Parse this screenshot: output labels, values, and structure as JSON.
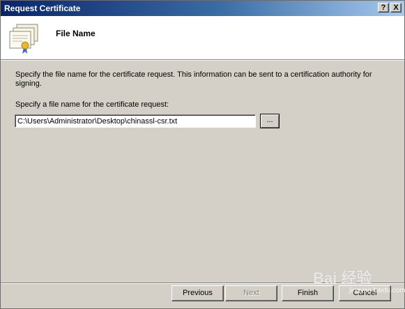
{
  "window": {
    "title": "Request Certificate",
    "help_label": "?",
    "close_label": "X"
  },
  "header": {
    "title": "File Name",
    "icon": "certificate-icon"
  },
  "content": {
    "description": "Specify the file name for the certificate request. This information can be sent to a certification authority for signing.",
    "field_label": "Specify a file name for the certificate request:",
    "file_value": "C:\\Users\\Administrator\\Desktop\\chinassl-csr.txt",
    "browse_label": "..."
  },
  "buttons": {
    "previous": "Previous",
    "next": "Next",
    "finish": "Finish",
    "cancel": "Cancel"
  },
  "watermark": {
    "text": "Bai 经验",
    "sub": "jingyan.baidu.com"
  }
}
